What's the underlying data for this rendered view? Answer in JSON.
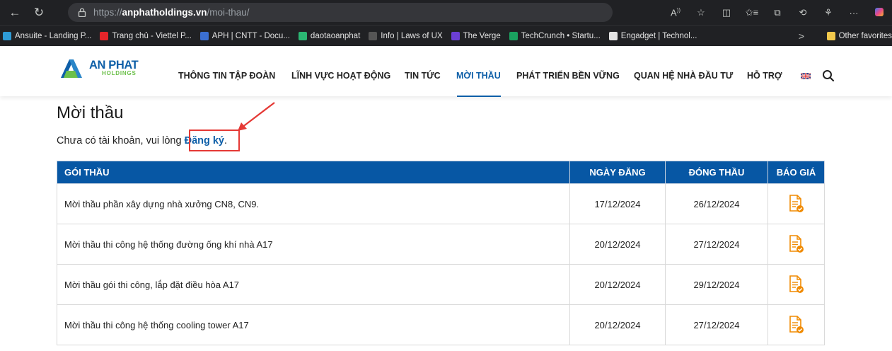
{
  "browser": {
    "url_scheme": "https://",
    "url_host": "anphatholdings.vn",
    "url_path": "/moi-thau/",
    "toolbar_icons": [
      "read-aloud-icon",
      "favorite-star-icon",
      "split-screen-icon",
      "favorites-icon",
      "collections-icon",
      "history-icon",
      "extensions-icon",
      "more-icon",
      "copilot-icon"
    ],
    "bookmarks": [
      {
        "label": "Ansuite - Landing P...",
        "color": "#2e9bd6"
      },
      {
        "label": "Trang chủ - Viettel P...",
        "color": "#e5252a"
      },
      {
        "label": "APH | CNTT - Docu...",
        "color": "#3b6fd1"
      },
      {
        "label": "daotaoanphat",
        "color": "#2bb673"
      },
      {
        "label": "Info | Laws of UX",
        "color": "#555555"
      },
      {
        "label": "The Verge",
        "color": "#6b3fd4"
      },
      {
        "label": "TechCrunch • Startu...",
        "color": "#1aa260"
      },
      {
        "label": "Engadget | Technol...",
        "color": "#e3e3e3"
      }
    ],
    "bookmarks_more": ">",
    "other_favorites": "Other favorites"
  },
  "header": {
    "logo_name": "AN PHAT",
    "logo_sub": "HOLDINGS",
    "nav": [
      {
        "label": "THÔNG TIN TẬP ĐOÀN",
        "active": false
      },
      {
        "label": "LĨNH VỰC HOẠT ĐỘNG",
        "active": false
      },
      {
        "label": "TIN TỨC",
        "active": false
      },
      {
        "label": "MỜI THẦU",
        "active": true
      },
      {
        "label": "PHÁT TRIỂN BỀN VỮNG",
        "active": false
      },
      {
        "label": "QUAN HỆ NHÀ ĐẦU TƯ",
        "active": false
      },
      {
        "label": "HỖ TRỢ",
        "active": false
      }
    ],
    "accent_color": "#0e5fa8"
  },
  "page": {
    "title": "Mời thầu",
    "register_prompt": "Chưa có tài khoản, vui lòng ",
    "register_link": "Đăng ký",
    "register_suffix": "."
  },
  "table": {
    "headers": [
      "GÓI THẦU",
      "NGÀY ĐĂNG",
      "ĐÓNG THẦU",
      "BÁO GIÁ"
    ],
    "rows": [
      {
        "name": "Mời thầu phần xây dựng nhà xưởng CN8, CN9.",
        "posted": "17/12/2024",
        "closing": "26/12/2024"
      },
      {
        "name": "Mời thầu thi công hệ thống đường ống khí nhà A17",
        "posted": "20/12/2024",
        "closing": "27/12/2024"
      },
      {
        "name": "Mời thầu gói thi công, lắp đặt điều hòa A17",
        "posted": "20/12/2024",
        "closing": "29/12/2024"
      },
      {
        "name": "Mời thầu thi công hệ thống cooling tower A17",
        "posted": "20/12/2024",
        "closing": "27/12/2024"
      }
    ]
  }
}
